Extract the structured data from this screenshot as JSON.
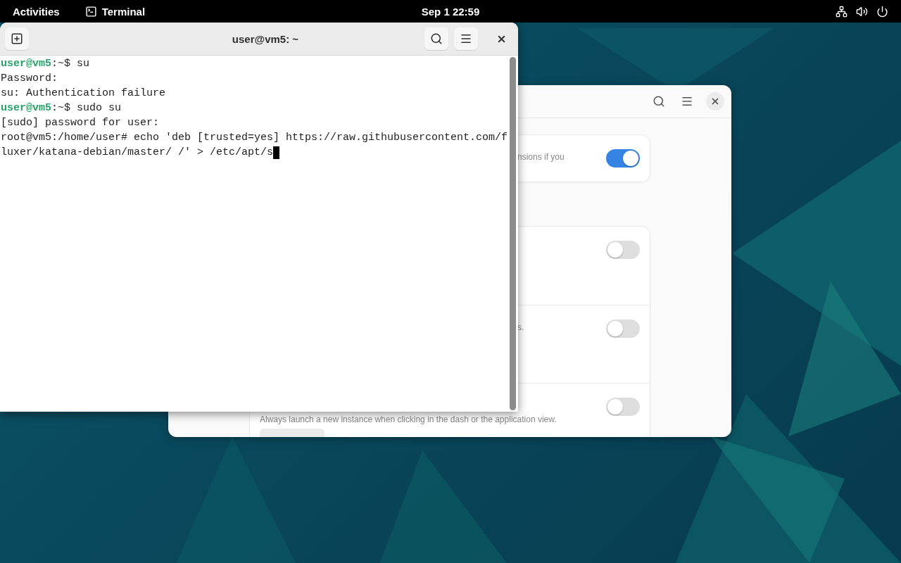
{
  "top_bar": {
    "activities": "Activities",
    "app_name": "Terminal",
    "clock": "Sep 1  22:59"
  },
  "terminal": {
    "title": "user@vm5: ~",
    "lines": [
      {
        "segments": [
          {
            "kind": "prompt",
            "text": "user@vm5"
          },
          {
            "kind": "plain",
            "text": ":~$ su"
          }
        ]
      },
      {
        "segments": [
          {
            "kind": "plain",
            "text": "Password:"
          }
        ]
      },
      {
        "segments": [
          {
            "kind": "plain",
            "text": "su: Authentication failure"
          }
        ]
      },
      {
        "segments": [
          {
            "kind": "prompt",
            "text": "user@vm5"
          },
          {
            "kind": "plain",
            "text": ":~$ sudo su"
          }
        ]
      },
      {
        "segments": [
          {
            "kind": "plain",
            "text": "[sudo] password for user:"
          }
        ]
      },
      {
        "segments": [
          {
            "kind": "plain",
            "text": "root@vm5:/home/user# echo 'deb [trusted=yes] https://raw.githubusercontent.com/f"
          }
        ]
      },
      {
        "segments": [
          {
            "kind": "plain",
            "text": "luxer/katana-debian/master/ /' > /etc/apt/s"
          }
        ],
        "cursor": true
      }
    ]
  },
  "extensions_window": {
    "cards": [
      {
        "rows": [
          {
            "kind": "partial",
            "description": "nsions if you",
            "on": true
          }
        ]
      },
      {
        "rows": [
          {
            "kind": "partial",
            "on": false
          },
          {
            "kind": "partial",
            "description": "s.",
            "on": false
          },
          {
            "kind": "full",
            "description": "Always launch a new instance when clicking in the dash or the application view.",
            "on": false,
            "has_button": true
          }
        ]
      }
    ]
  }
}
